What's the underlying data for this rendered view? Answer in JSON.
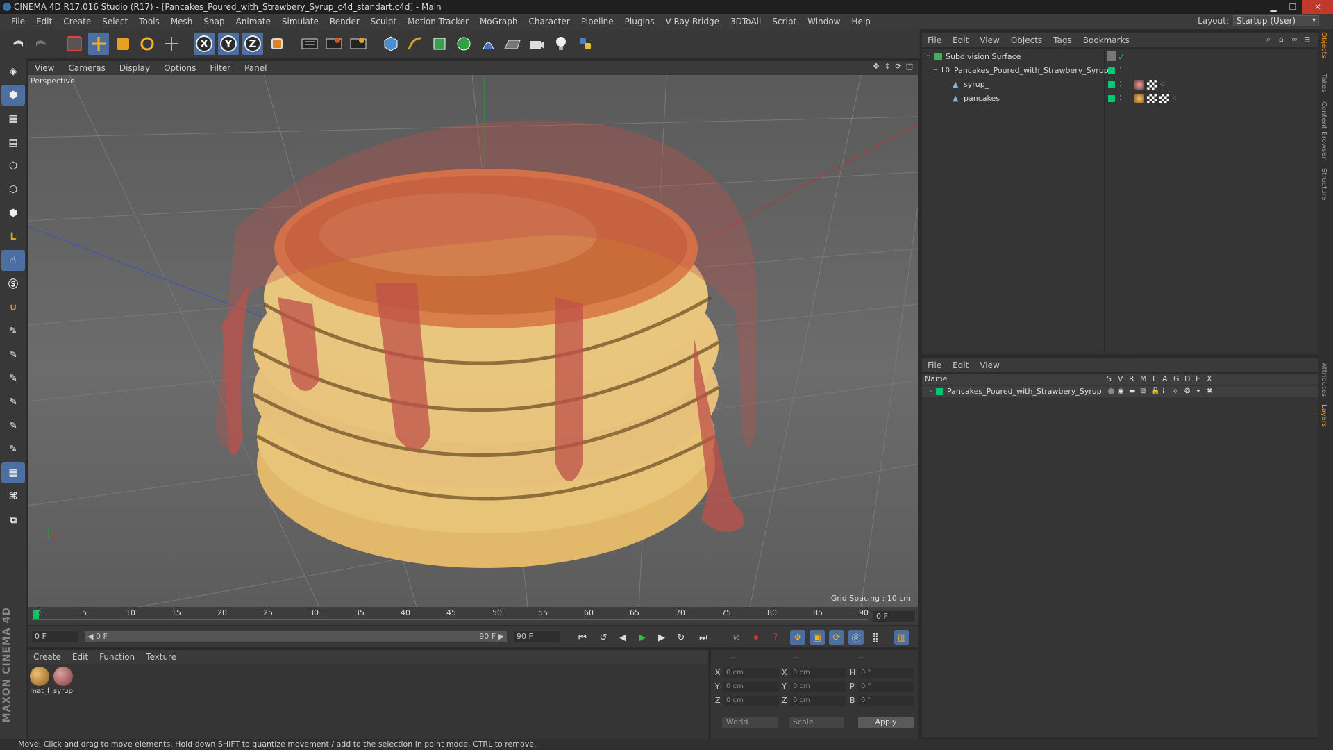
{
  "window": {
    "title": "CINEMA 4D R17.016 Studio (R17) - [Pancakes_Poured_with_Strawbery_Syrup_c4d_standart.c4d] - Main"
  },
  "menu": [
    "File",
    "Edit",
    "Create",
    "Select",
    "Tools",
    "Mesh",
    "Snap",
    "Animate",
    "Simulate",
    "Render",
    "Sculpt",
    "Motion Tracker",
    "MoGraph",
    "Character",
    "Pipeline",
    "Plugins",
    "V-Ray Bridge",
    "3DToAll",
    "Script",
    "Window",
    "Help"
  ],
  "layout": {
    "label": "Layout:",
    "value": "Startup (User)"
  },
  "toolbar": {
    "axis_x": "X",
    "axis_y": "Y",
    "axis_z": "Z"
  },
  "viewport": {
    "menu": [
      "View",
      "Cameras",
      "Display",
      "Options",
      "Filter",
      "Panel"
    ],
    "label": "Perspective",
    "grid_spacing": "Grid Spacing : 10 cm"
  },
  "timeline": {
    "ticks": [
      "0",
      "5",
      "10",
      "15",
      "20",
      "25",
      "30",
      "35",
      "40",
      "45",
      "50",
      "55",
      "60",
      "65",
      "70",
      "75",
      "80",
      "85",
      "90"
    ],
    "current_frame": "0 F"
  },
  "transport": {
    "start_frame": "0 F",
    "range_start": "◀ 0 F",
    "range_end": "90 F ▶",
    "end_frame": "90 F"
  },
  "material_manager": {
    "menu": [
      "Create",
      "Edit",
      "Function",
      "Texture"
    ],
    "materials": [
      {
        "name": "mat_l",
        "color": "#c8923a"
      },
      {
        "name": "syrup",
        "color": "#b8686a"
      }
    ]
  },
  "coordinates": {
    "headers": [
      "--",
      "--",
      "--"
    ],
    "rows": [
      {
        "a": "X",
        "av": "0 cm",
        "b": "X",
        "bv": "0 cm",
        "c": "H",
        "cv": "0 °"
      },
      {
        "a": "Y",
        "av": "0 cm",
        "b": "Y",
        "bv": "0 cm",
        "c": "P",
        "cv": "0 °"
      },
      {
        "a": "Z",
        "av": "0 cm",
        "b": "Z",
        "bv": "0 cm",
        "c": "B",
        "cv": "0 °"
      }
    ],
    "space": "World",
    "mode": "Scale",
    "apply": "Apply"
  },
  "objects_panel": {
    "menu": [
      "File",
      "Edit",
      "View",
      "Objects",
      "Tags",
      "Bookmarks"
    ],
    "items": [
      {
        "name": "Subdivision Surface"
      },
      {
        "name": "Pancakes_Poured_with_Strawbery_Syrup"
      },
      {
        "name": "syrup_"
      },
      {
        "name": "pancakes"
      }
    ]
  },
  "layers_panel": {
    "menu": [
      "File",
      "Edit",
      "View"
    ],
    "columns": [
      "Name",
      "S",
      "V",
      "R",
      "M",
      "L",
      "A",
      "G",
      "D",
      "E",
      "X"
    ],
    "rows": [
      {
        "name": "Pancakes_Poured_with_Strawbery_Syrup"
      }
    ]
  },
  "right_tabs": [
    "Objects",
    "Takes",
    "Content Browser",
    "Structure",
    "Attributes",
    "Layers"
  ],
  "status": "Move: Click and drag to move elements. Hold down SHIFT to quantize movement / add to the selection in point mode, CTRL to remove.",
  "branding": "MAXON CINEMA 4D"
}
